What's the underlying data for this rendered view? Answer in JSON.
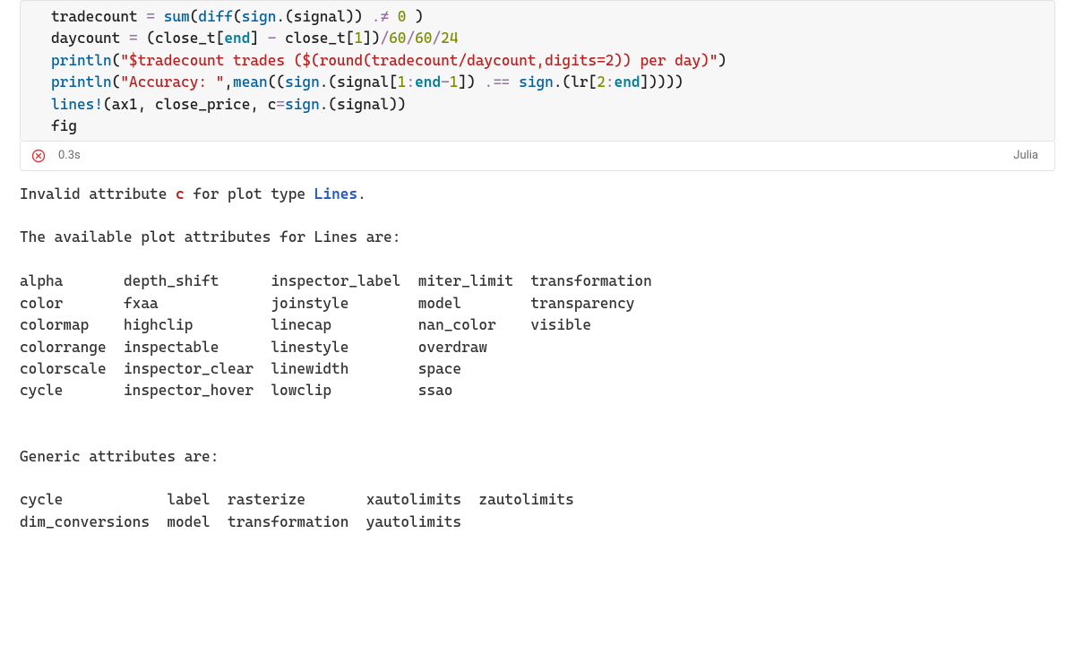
{
  "cell": {
    "code_lines": [
      [
        {
          "t": "ident",
          "v": "tradecount "
        },
        {
          "t": "op",
          "v": "="
        },
        {
          "t": "ident",
          "v": " "
        },
        {
          "t": "fn",
          "v": "sum"
        },
        {
          "t": "par",
          "v": "("
        },
        {
          "t": "fn",
          "v": "diff"
        },
        {
          "t": "par",
          "v": "("
        },
        {
          "t": "fn",
          "v": "sign"
        },
        {
          "t": "par",
          "v": ".("
        },
        {
          "t": "ident",
          "v": "signal"
        },
        {
          "t": "par",
          "v": "))"
        },
        {
          "t": "ident",
          "v": " "
        },
        {
          "t": "op",
          "v": ".≠"
        },
        {
          "t": "ident",
          "v": " "
        },
        {
          "t": "num",
          "v": "0"
        },
        {
          "t": "ident",
          "v": " "
        },
        {
          "t": "par",
          "v": ")"
        }
      ],
      [
        {
          "t": "ident",
          "v": "daycount "
        },
        {
          "t": "op",
          "v": "="
        },
        {
          "t": "ident",
          "v": " "
        },
        {
          "t": "par",
          "v": "("
        },
        {
          "t": "ident",
          "v": "close_t"
        },
        {
          "t": "par",
          "v": "["
        },
        {
          "t": "end",
          "v": "end"
        },
        {
          "t": "par",
          "v": "]"
        },
        {
          "t": "ident",
          "v": " "
        },
        {
          "t": "op",
          "v": "-"
        },
        {
          "t": "ident",
          "v": " close_t"
        },
        {
          "t": "par",
          "v": "["
        },
        {
          "t": "num",
          "v": "1"
        },
        {
          "t": "par",
          "v": "])"
        },
        {
          "t": "op",
          "v": "/"
        },
        {
          "t": "num",
          "v": "60"
        },
        {
          "t": "op",
          "v": "/"
        },
        {
          "t": "num",
          "v": "60"
        },
        {
          "t": "op",
          "v": "/"
        },
        {
          "t": "num",
          "v": "24"
        }
      ],
      [
        {
          "t": "fn",
          "v": "println"
        },
        {
          "t": "par",
          "v": "("
        },
        {
          "t": "str",
          "v": "\"$tradecount trades ($(round(tradecount/daycount,digits=2)) per day)\""
        },
        {
          "t": "par",
          "v": ")"
        }
      ],
      [
        {
          "t": "fn",
          "v": "println"
        },
        {
          "t": "par",
          "v": "("
        },
        {
          "t": "str",
          "v": "\"Accuracy: \""
        },
        {
          "t": "par",
          "v": ","
        },
        {
          "t": "fn",
          "v": "mean"
        },
        {
          "t": "par",
          "v": "(("
        },
        {
          "t": "fn",
          "v": "sign"
        },
        {
          "t": "par",
          "v": ".("
        },
        {
          "t": "ident",
          "v": "signal"
        },
        {
          "t": "par",
          "v": "["
        },
        {
          "t": "num",
          "v": "1"
        },
        {
          "t": "op",
          "v": ":"
        },
        {
          "t": "end",
          "v": "end"
        },
        {
          "t": "op",
          "v": "-"
        },
        {
          "t": "num",
          "v": "1"
        },
        {
          "t": "par",
          "v": "])"
        },
        {
          "t": "ident",
          "v": " "
        },
        {
          "t": "op",
          "v": ".=="
        },
        {
          "t": "ident",
          "v": " "
        },
        {
          "t": "fn",
          "v": "sign"
        },
        {
          "t": "par",
          "v": ".("
        },
        {
          "t": "ident",
          "v": "lr"
        },
        {
          "t": "par",
          "v": "["
        },
        {
          "t": "num",
          "v": "2"
        },
        {
          "t": "op",
          "v": ":"
        },
        {
          "t": "end",
          "v": "end"
        },
        {
          "t": "par",
          "v": "]))))"
        }
      ],
      [
        {
          "t": "fn",
          "v": "lines!"
        },
        {
          "t": "par",
          "v": "("
        },
        {
          "t": "ident",
          "v": "ax1"
        },
        {
          "t": "par",
          "v": ","
        },
        {
          "t": "ident",
          "v": " close_price"
        },
        {
          "t": "par",
          "v": ","
        },
        {
          "t": "ident",
          "v": " c"
        },
        {
          "t": "op",
          "v": "="
        },
        {
          "t": "fn",
          "v": "sign"
        },
        {
          "t": "par",
          "v": ".("
        },
        {
          "t": "ident",
          "v": "signal"
        },
        {
          "t": "par",
          "v": "))"
        }
      ],
      [
        {
          "t": "ident",
          "v": "fig"
        }
      ]
    ],
    "status": {
      "icon": "error-icon",
      "time": "0.3s",
      "language": "Julia"
    }
  },
  "error": {
    "prefix": "Invalid attribute ",
    "attr": "c",
    "mid": " for plot type ",
    "type": "Lines",
    "suffix": ".",
    "available_heading": "The available plot attributes for Lines are:",
    "plot_attrs_cols": [
      [
        "alpha",
        "color",
        "colormap",
        "colorrange",
        "colorscale",
        "cycle"
      ],
      [
        "depth_shift",
        "fxaa",
        "highclip",
        "inspectable",
        "inspector_clear",
        "inspector_hover"
      ],
      [
        "inspector_label",
        "joinstyle",
        "linecap",
        "linestyle",
        "linewidth",
        "lowclip"
      ],
      [
        "miter_limit",
        "model",
        "nan_color",
        "overdraw",
        "space",
        "ssao"
      ],
      [
        "transformation",
        "transparency",
        "visible"
      ]
    ],
    "plot_col_widths": [
      12,
      17,
      17,
      13,
      14
    ],
    "generic_heading": "Generic attributes are:",
    "generic_cols": [
      [
        "cycle",
        "dim_conversions"
      ],
      [
        "label",
        "model"
      ],
      [
        "rasterize",
        "transformation"
      ],
      [
        "xautolimits",
        "yautolimits"
      ],
      [
        "zautolimits"
      ]
    ],
    "generic_col_widths": [
      17,
      7,
      16,
      13,
      11
    ]
  }
}
